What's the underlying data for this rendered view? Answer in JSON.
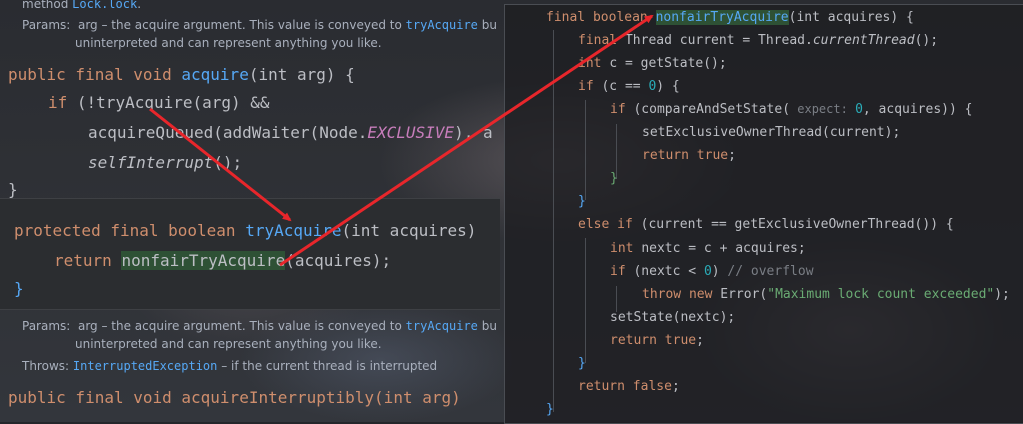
{
  "top_doc": {
    "method_label": "method",
    "method_link": "Lock.lock",
    "method_end": ".",
    "params_label": "Params:",
    "params_text": "arg – the acquire argument. This value is conveyed to",
    "params_link": "tryAcquire",
    "params_cut": "bu",
    "params_text2": "uninterpreted and can represent anything you like."
  },
  "left_code": {
    "l1": {
      "kw": "public final void ",
      "fn": "acquire",
      "rest": "(int arg) {"
    },
    "l2": {
      "kw": "if ",
      "rest": "(!tryAcquire(arg) &&"
    },
    "l3": {
      "a": "acquireQueued(addWaiter(Node.",
      "cst": "EXCLUSIVE",
      "b": "), a"
    },
    "l4": {
      "it": "selfInterrupt",
      "rest": "();"
    },
    "l5": "}"
  },
  "mid_code": {
    "l1": {
      "kw": "protected final boolean ",
      "fn": "tryAcquire",
      "rest": "(int acquires)"
    },
    "l2": {
      "kw": "return ",
      "hl": "nonfairTryAcquire",
      "rest": "(acquires);"
    },
    "l3": "}"
  },
  "bottom_doc": {
    "params_label": "Params:",
    "params_text": "arg – the acquire argument. This value is conveyed to",
    "params_link": "tryAcquire",
    "params_cut": "bu",
    "params_text2": "uninterpreted and can represent anything you like.",
    "throws_label": "Throws:",
    "throws_link": "InterruptedException",
    "throws_text": "– if the current thread is interrupted",
    "next_method": "public final void acquireInterruptibly(int arg)"
  },
  "right_code": {
    "l1": {
      "kw": "final boolean ",
      "fn": "nonfairTryAcquire",
      "rest": "(int acquires) {"
    },
    "l2": {
      "kw": "final ",
      "a": "Thread current = Thread.",
      "it": "currentThread",
      "b": "();"
    },
    "l3": {
      "kw": "int ",
      "rest": "c = getState();"
    },
    "l4": {
      "kw": "if ",
      "a": "(c == ",
      "num": "0",
      "b": ") {"
    },
    "l5": {
      "kw": "if ",
      "a": "(compareAndSetState(",
      "hint": " expect: ",
      "num": "0",
      "b": ", acquires)) {"
    },
    "l6": "setExclusiveOwnerThread(current);",
    "l7": {
      "kw": "return ",
      "kw2": "true",
      "b": ";"
    },
    "l8": "}",
    "l9": "}",
    "l10": {
      "kw": "else if ",
      "rest": "(current == getExclusiveOwnerThread()) {"
    },
    "l11": {
      "kw": "int ",
      "rest": "nextc = c + acquires;"
    },
    "l12": {
      "kw": "if ",
      "a": "(nextc < ",
      "num": "0",
      "b": ") ",
      "cmt": "// overflow"
    },
    "l13": {
      "kw": "throw new ",
      "a": "Error(",
      "str": "\"Maximum lock count exceeded\"",
      "b": ");"
    },
    "l14": "setState(nextc);",
    "l15": {
      "kw": "return ",
      "kw2": "true",
      "b": ";"
    },
    "l16": "}",
    "l17": {
      "kw": "return ",
      "kw2": "false",
      "b": ";"
    },
    "l18": "}"
  },
  "colors": {
    "keyword": "#cf8e6d",
    "function": "#56a8f5",
    "text": "#bcbec4",
    "number": "#2aacb8",
    "string": "#6aab73",
    "arrow": "#e8262b",
    "highlight": "#2e5135"
  }
}
